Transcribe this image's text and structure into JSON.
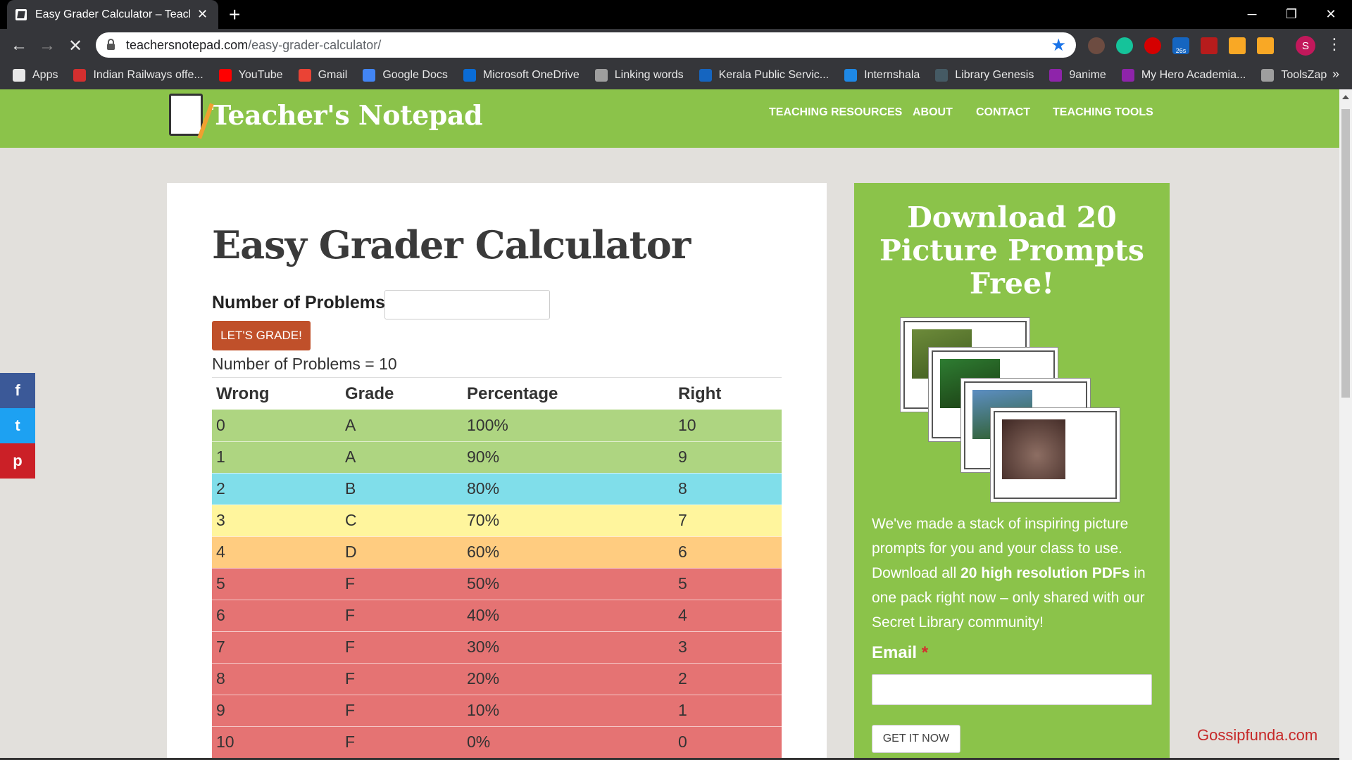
{
  "browser": {
    "tab_title": "Easy Grader Calculator – Teacher",
    "url_domain": "teachersnotepad.com",
    "url_path": "/easy-grader-calculator/",
    "bookmarks": [
      {
        "label": "Apps",
        "icon": "apps-grid-icon",
        "color": "#e8e8e8"
      },
      {
        "label": "Indian Railways offe...",
        "icon": "indian-railways-icon",
        "color": "#d32f2f"
      },
      {
        "label": "YouTube",
        "icon": "youtube-icon",
        "color": "#ff0000"
      },
      {
        "label": "Gmail",
        "icon": "gmail-icon",
        "color": "#ea4335"
      },
      {
        "label": "Google Docs",
        "icon": "google-docs-icon",
        "color": "#4285f4"
      },
      {
        "label": "Microsoft OneDrive",
        "icon": "onedrive-icon",
        "color": "#0a6cd6"
      },
      {
        "label": "Linking words",
        "icon": "globe-icon",
        "color": "#9e9e9e"
      },
      {
        "label": "Kerala Public Servic...",
        "icon": "kpsc-icon",
        "color": "#1565c0"
      },
      {
        "label": "Internshala",
        "icon": "internshala-icon",
        "color": "#1e88e5"
      },
      {
        "label": "Library Genesis",
        "icon": "library-genesis-icon",
        "color": "#455a64"
      },
      {
        "label": "9anime",
        "icon": "play-icon",
        "color": "#8e24aa"
      },
      {
        "label": "My Hero Academia...",
        "icon": "play-icon",
        "color": "#8e24aa"
      },
      {
        "label": "ToolsZap",
        "icon": "globe-icon",
        "color": "#9e9e9e"
      }
    ],
    "profile_initial": "S",
    "extension_badge": "26s"
  },
  "site": {
    "logo_text": "Teacher's Notepad",
    "nav": [
      "TEACHING RESOURCES",
      "ABOUT",
      "CONTACT",
      "TEACHING TOOLS"
    ],
    "accent_color": "#8bc34a"
  },
  "calculator": {
    "title": "Easy Grader Calculator",
    "problems_label": "Number of Problems:",
    "problems_value": "",
    "button_label": "LET'S GRADE!",
    "result_text": "Number of Problems = 10",
    "headers": [
      "Wrong",
      "Grade",
      "Percentage",
      "Right"
    ],
    "rows": [
      {
        "wrong": "0",
        "grade": "A",
        "percentage": "100%",
        "right": "10",
        "color": "#aed581"
      },
      {
        "wrong": "1",
        "grade": "A",
        "percentage": "90%",
        "right": "9",
        "color": "#aed581"
      },
      {
        "wrong": "2",
        "grade": "B",
        "percentage": "80%",
        "right": "8",
        "color": "#80deea"
      },
      {
        "wrong": "3",
        "grade": "C",
        "percentage": "70%",
        "right": "7",
        "color": "#fff59d"
      },
      {
        "wrong": "4",
        "grade": "D",
        "percentage": "60%",
        "right": "6",
        "color": "#ffcc80"
      },
      {
        "wrong": "5",
        "grade": "F",
        "percentage": "50%",
        "right": "5",
        "color": "#e57373"
      },
      {
        "wrong": "6",
        "grade": "F",
        "percentage": "40%",
        "right": "4",
        "color": "#e57373"
      },
      {
        "wrong": "7",
        "grade": "F",
        "percentage": "30%",
        "right": "3",
        "color": "#e57373"
      },
      {
        "wrong": "8",
        "grade": "F",
        "percentage": "20%",
        "right": "2",
        "color": "#e57373"
      },
      {
        "wrong": "9",
        "grade": "F",
        "percentage": "10%",
        "right": "1",
        "color": "#e57373"
      },
      {
        "wrong": "10",
        "grade": "F",
        "percentage": "0%",
        "right": "0",
        "color": "#e57373"
      }
    ]
  },
  "sidebar": {
    "title": "Download 20 Picture Prompts Free!",
    "text_before": "We've made a stack of inspiring picture prompts for you and your class to use. Download all ",
    "text_bold": "20 high resolution PDFs",
    "text_after": " in one pack right now – only shared with our Secret Library community!",
    "email_label": "Email",
    "required_mark": "*",
    "email_value": "",
    "button_label": "GET IT NOW"
  },
  "social": [
    {
      "icon": "facebook-icon",
      "glyph": "f",
      "color": "#3b5998"
    },
    {
      "icon": "twitter-icon",
      "glyph": "t",
      "color": "#1da1f2"
    },
    {
      "icon": "pinterest-icon",
      "glyph": "p",
      "color": "#cb2027"
    }
  ],
  "watermark": "Gossipfunda.com"
}
